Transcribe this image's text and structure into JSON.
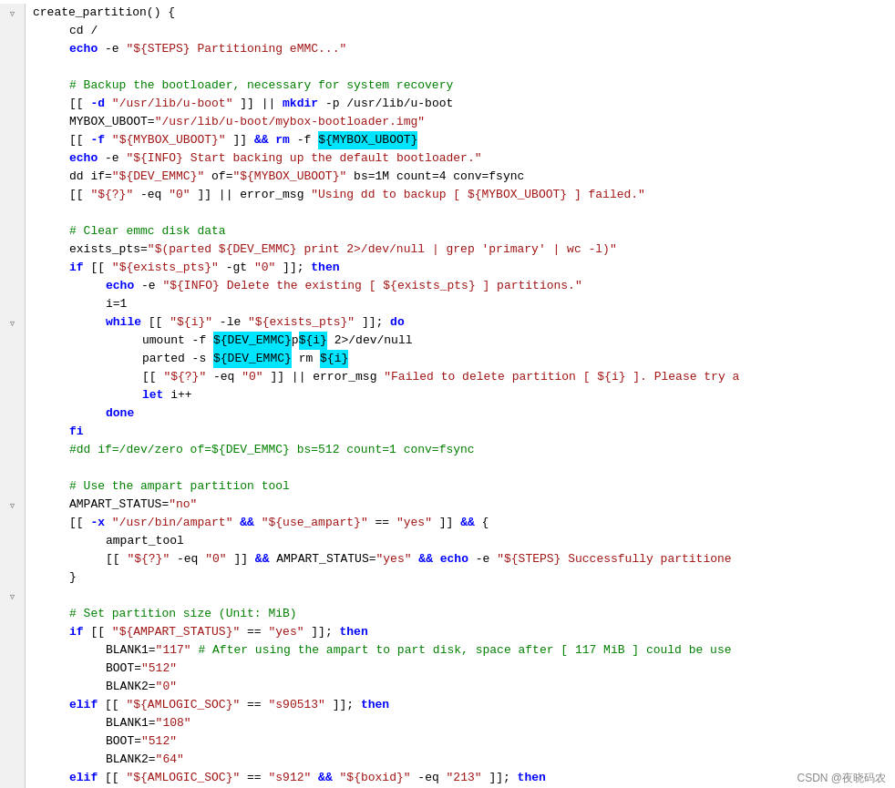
{
  "watermark": "CSDN @夜晓码农",
  "lines": [
    {
      "gutter": "fold",
      "indent": 0,
      "content": "create_partition() {"
    },
    {
      "gutter": "",
      "indent": 1,
      "content": "cd /"
    },
    {
      "gutter": "",
      "indent": 1,
      "content": "echo -e \"${STEPS} Partitioning eMMC...\""
    },
    {
      "gutter": "",
      "indent": 0,
      "content": ""
    },
    {
      "gutter": "",
      "indent": 1,
      "content": "# Backup the bootloader, necessary for system recovery"
    },
    {
      "gutter": "",
      "indent": 1,
      "content": "[[ -d \"/usr/lib/u-boot\" ]] || mkdir -p /usr/lib/u-boot"
    },
    {
      "gutter": "",
      "indent": 1,
      "content": "MYBOX_UBOOT=\"/usr/lib/u-boot/mybox-bootloader.img\""
    },
    {
      "gutter": "",
      "indent": 1,
      "content": "[[ -f \"${MYBOX_UBOOT}\" ]] && rm -f ${MYBOX_UBOOT}"
    },
    {
      "gutter": "",
      "indent": 1,
      "content": "echo -e \"${INFO} Start backing up the default bootloader.\""
    },
    {
      "gutter": "",
      "indent": 1,
      "content": "dd if=\"${DEV_EMMC}\" of=\"${MYBOX_UBOOT}\" bs=1M count=4 conv=fsync"
    },
    {
      "gutter": "",
      "indent": 1,
      "content": "[[ \"${?}\" -eq \"0\" ]] || error_msg \"Using dd to backup [ ${MYBOX_UBOOT} ] failed.\""
    },
    {
      "gutter": "",
      "indent": 0,
      "content": ""
    },
    {
      "gutter": "",
      "indent": 1,
      "content": "# Clear emmc disk data"
    },
    {
      "gutter": "",
      "indent": 1,
      "content": "exists_pts=\"$(parted ${DEV_EMMC} print 2>/dev/null | grep 'primary' | wc -l)\""
    },
    {
      "gutter": "",
      "indent": 1,
      "content": "if [[ \"${exists_pts}\" -gt \"0\" ]]; then"
    },
    {
      "gutter": "",
      "indent": 2,
      "content": "echo -e \"${INFO} Delete the existing [ ${exists_pts} ] partitions.\""
    },
    {
      "gutter": "",
      "indent": 2,
      "content": "i=1"
    },
    {
      "gutter": "fold",
      "indent": 2,
      "content": "while [[ \"${i}\" -le \"${exists_pts}\" ]]; do"
    },
    {
      "gutter": "",
      "indent": 3,
      "content": "umount -f ${DEV_EMMC}p${i} 2>/dev/null"
    },
    {
      "gutter": "",
      "indent": 3,
      "content": "parted -s ${DEV_EMMC} rm ${i}"
    },
    {
      "gutter": "",
      "indent": 3,
      "content": "[[ \"${?}\" -eq \"0\" ]] || error_msg \"Failed to delete partition [ ${i} ]. Please try a"
    },
    {
      "gutter": "",
      "indent": 3,
      "content": "let i++"
    },
    {
      "gutter": "",
      "indent": 2,
      "content": "done"
    },
    {
      "gutter": "",
      "indent": 1,
      "content": "fi"
    },
    {
      "gutter": "",
      "indent": 1,
      "content": "#dd if=/dev/zero of=${DEV_EMMC} bs=512 count=1 conv=fsync"
    },
    {
      "gutter": "",
      "indent": 0,
      "content": ""
    },
    {
      "gutter": "",
      "indent": 1,
      "content": "# Use the ampart partition tool"
    },
    {
      "gutter": "",
      "indent": 1,
      "content": "AMPART_STATUS=\"no\""
    },
    {
      "gutter": "fold",
      "indent": 1,
      "content": "[[ -x \"/usr/bin/ampart\" && \"${use_ampart}\" == \"yes\" ]] && {"
    },
    {
      "gutter": "",
      "indent": 2,
      "content": "ampart_tool"
    },
    {
      "gutter": "",
      "indent": 2,
      "content": "[[ \"${?}\" -eq \"0\" ]] && AMPART_STATUS=\"yes\" && echo -e \"${STEPS} Successfully partitione"
    },
    {
      "gutter": "",
      "indent": 1,
      "content": "}"
    },
    {
      "gutter": "",
      "indent": 0,
      "content": ""
    },
    {
      "gutter": "",
      "indent": 1,
      "content": "# Set partition size (Unit: MiB)"
    },
    {
      "gutter": "fold",
      "indent": 1,
      "content": "if [[ \"${AMPART_STATUS}\" == \"yes\" ]]; then"
    },
    {
      "gutter": "",
      "indent": 2,
      "content": "BLANK1=\"117\" # After using the ampart to part disk, space after [ 117 MiB ] could be use"
    },
    {
      "gutter": "",
      "indent": 2,
      "content": "BOOT=\"512\""
    },
    {
      "gutter": "",
      "indent": 2,
      "content": "BLANK2=\"0\""
    },
    {
      "gutter": "",
      "indent": 1,
      "content": "elif [[ \"${AMLOGIC_SOC}\" == \"s90513\" ]]; then"
    },
    {
      "gutter": "",
      "indent": 2,
      "content": "BLANK1=\"108\""
    },
    {
      "gutter": "",
      "indent": 2,
      "content": "BOOT=\"512\""
    },
    {
      "gutter": "",
      "indent": 2,
      "content": "BLANK2=\"64\""
    },
    {
      "gutter": "",
      "indent": 1,
      "content": "elif [[ \"${AMLOGIC_SOC}\" == \"s912\" && \"${boxid}\" -eq \"213\" ]]; then"
    }
  ]
}
